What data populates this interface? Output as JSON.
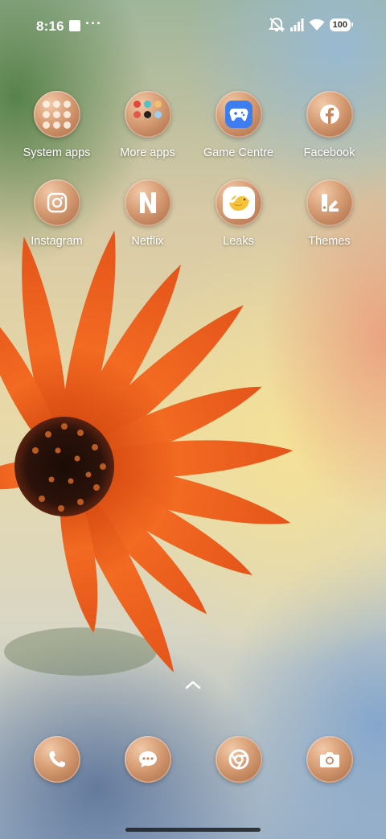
{
  "status_bar": {
    "time": "8:16",
    "notification_dots": "···",
    "battery": "100",
    "icons": [
      "screen-record-icon",
      "more-notifications-icon",
      "mute-vibrate-icon",
      "signal-icon",
      "wifi-icon",
      "battery-icon"
    ]
  },
  "apps": [
    {
      "label": "System apps",
      "icon": "folder-icon"
    },
    {
      "label": "More apps",
      "icon": "folder-icon"
    },
    {
      "label": "Game Centre",
      "icon": "gamepad-icon"
    },
    {
      "label": "Facebook",
      "icon": "facebook-icon"
    },
    {
      "label": "Instagram",
      "icon": "instagram-icon"
    },
    {
      "label": "Netflix",
      "icon": "netflix-icon"
    },
    {
      "label": "Leaks",
      "icon": "bird-icon"
    },
    {
      "label": "Themes",
      "icon": "themes-icon"
    }
  ],
  "dock": [
    {
      "icon": "phone-icon"
    },
    {
      "icon": "messages-icon"
    },
    {
      "icon": "chrome-icon"
    },
    {
      "icon": "camera-icon"
    }
  ],
  "colors": {
    "icon_bronze": "#c8865d",
    "game_centre_blue": "#3e7df0",
    "leaks_yellow": "#f5c33a"
  }
}
